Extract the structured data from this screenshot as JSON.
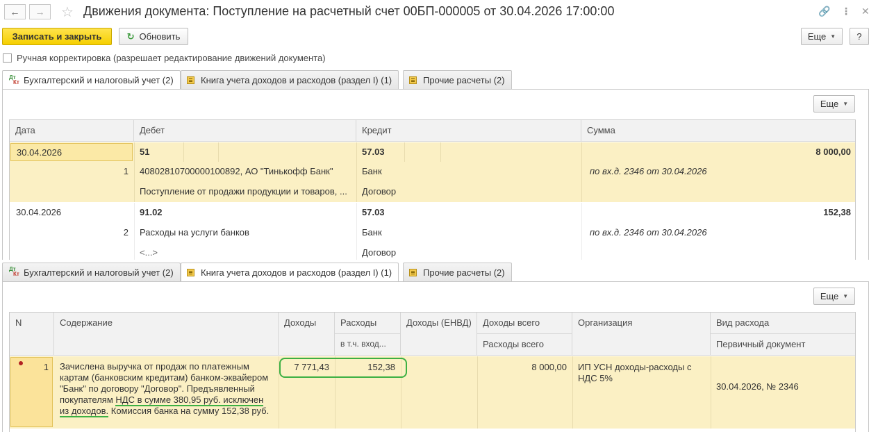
{
  "window": {
    "title": "Движения документа: Поступление на расчетный счет 00БП-000005 от 30.04.2026 17:00:00"
  },
  "toolbar": {
    "save_close": "Записать и закрыть",
    "refresh": "Обновить",
    "more": "Еще",
    "help": "?"
  },
  "manual_correction": {
    "label": "Ручная корректировка (разрешает редактирование движений документа)",
    "checked": false
  },
  "tabs": [
    {
      "label": "Бухгалтерский и налоговый учет (2)"
    },
    {
      "label": "Книга учета доходов и расходов (раздел I) (1)"
    },
    {
      "label": "Прочие расчеты (2)"
    }
  ],
  "tab_icon": {
    "dt": "Дт",
    "kt": "Кт"
  },
  "panel_more": "Еще",
  "accounting_table": {
    "headers": {
      "date": "Дата",
      "debit": "Дебет",
      "credit": "Кредит",
      "sum": "Сумма"
    },
    "rows": [
      {
        "date": "30.04.2026",
        "num": "1",
        "debit_account": "51",
        "debit_sub1": "40802810700000100892, АО \"Тинькофф Банк\"",
        "debit_sub2": "Поступление от продажи продукции и товаров, ...",
        "credit_account": "57.03",
        "credit_sub1": "Банк",
        "credit_sub2": "Договор",
        "sum": "8 000,00",
        "content": "по вх.д. 2346 от 30.04.2026"
      },
      {
        "date": "30.04.2026",
        "num": "2",
        "debit_account": "91.02",
        "debit_sub1": "Расходы на услуги банков",
        "debit_sub2": "<...>",
        "credit_account": "57.03",
        "credit_sub1": "Банк",
        "credit_sub2": "Договор",
        "sum": "152,38",
        "content": "по вх.д. 2346 от 30.04.2026"
      }
    ]
  },
  "kudir_table": {
    "headers": {
      "n": "N",
      "content": "Содержание",
      "income": "Доходы",
      "expenses": "Расходы",
      "expenses_sub": "в т.ч. вход...",
      "income_envd": "Доходы (ЕНВД)",
      "income_total": "Доходы всего",
      "expenses_total": "Расходы всего",
      "organization": "Организация",
      "expense_type": "Вид расхода",
      "primary_doc": "Первичный документ"
    },
    "rows": [
      {
        "n": "1",
        "content": "Зачислена выручка от продаж по платежным картам (банковским кредитам) банком-эквайером \"Банк\" по договору \"Договор\". Предъявленный покупателям НДС в сумме 380,95 руб. исключен из доходов. Комиссия банка на сумму 152,38 руб.",
        "content_lines": [
          "Зачислена выручка от продаж по платежным",
          "картам (банковским кредитам) банком-эквайером",
          "\"Банк\" по договору \"Договор\". Предъявленный",
          "покупателям ",
          "НДС в сумме 380,95 руб. исключен",
          "из доходов.",
          " Комиссия банка на сумму 152,38 руб."
        ],
        "income": "7 771,43",
        "expenses": "152,38",
        "income_envd": "",
        "income_total": "8 000,00",
        "expenses_total": "",
        "organization": "ИП УСН доходы-расходы с НДС 5%",
        "expense_type": "",
        "primary_doc": "30.04.2026, № 2346"
      }
    ]
  },
  "colors": {
    "highlight_row": "#fbf0c4",
    "primary_button": "#f5cf00",
    "annotation_green": "#3cb043"
  },
  "icons": [
    "back-arrow-icon",
    "forward-arrow-icon",
    "star-icon",
    "link-icon",
    "more-vertical-icon",
    "close-icon",
    "refresh-icon",
    "dt-kt-icon",
    "book-icon",
    "record-marker-icon"
  ]
}
